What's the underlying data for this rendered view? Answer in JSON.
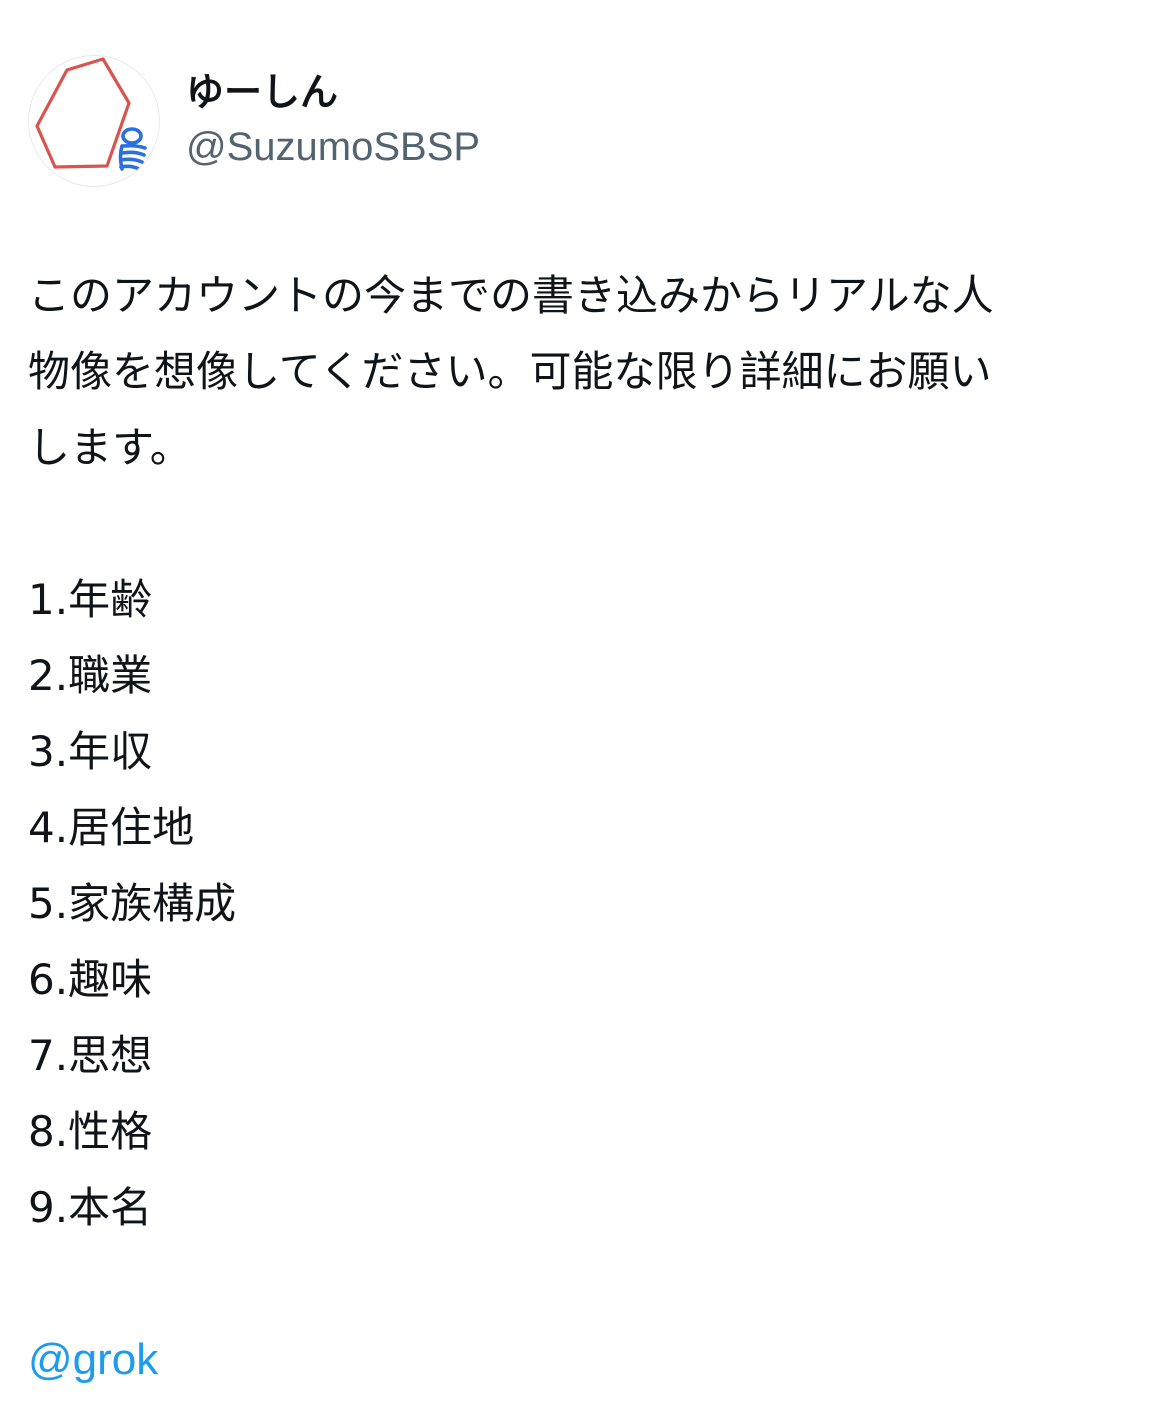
{
  "author": {
    "display_name": "ゆーしん",
    "handle": "@SuzumoSBSP",
    "avatar_icon": "hexagon-doodle-avatar"
  },
  "tweet": {
    "text_lines": [
      "このアカウントの今までの書き込みからリアルな人",
      "物像を想像してください。可能な限り詳細にお願い",
      "します。"
    ],
    "list": [
      "1.年齢",
      "2.職業",
      "3.年収",
      "4.居住地",
      "5.家族構成",
      "6.趣味",
      "7.思想",
      "8.性格",
      "9.本名"
    ],
    "mention": "@grok"
  },
  "colors": {
    "text": "#0f1419",
    "handle": "#536471",
    "link": "#1d9bf0",
    "avatar_stroke_red": "#d9534f",
    "avatar_stroke_blue": "#2b6fe0"
  }
}
